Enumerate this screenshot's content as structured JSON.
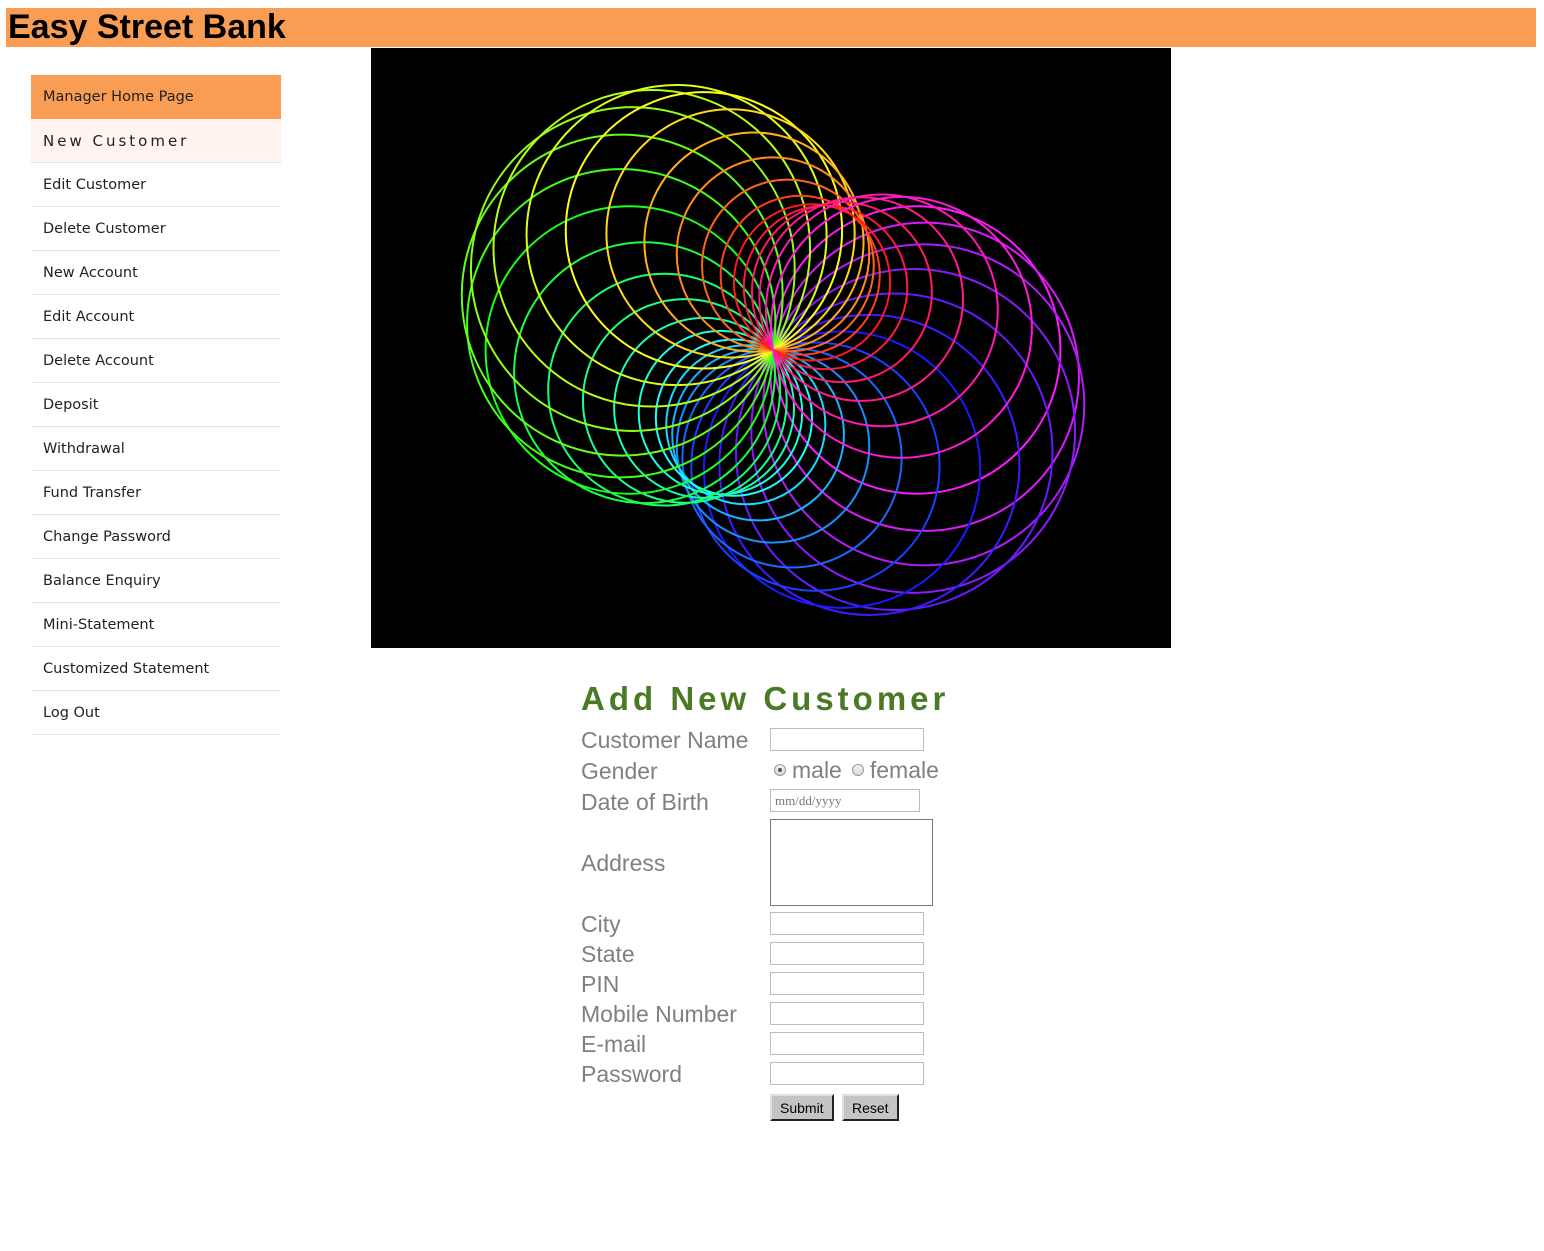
{
  "header": {
    "title": "Easy Street Bank"
  },
  "sidebar": {
    "items": [
      {
        "label": "Manager Home Page"
      },
      {
        "label": "New Customer"
      },
      {
        "label": "Edit Customer"
      },
      {
        "label": "Delete Customer"
      },
      {
        "label": "New Account"
      },
      {
        "label": "Edit Account"
      },
      {
        "label": "Delete Account"
      },
      {
        "label": "Deposit"
      },
      {
        "label": "Withdrawal"
      },
      {
        "label": "Fund Transfer"
      },
      {
        "label": "Change Password"
      },
      {
        "label": "Balance Enquiry"
      },
      {
        "label": "Mini-Statement"
      },
      {
        "label": "Customized Statement"
      },
      {
        "label": "Log Out"
      }
    ]
  },
  "form": {
    "title": "Add New Customer",
    "labels": {
      "customer_name": "Customer Name",
      "gender": "Gender",
      "dob": "Date of Birth",
      "address": "Address",
      "city": "City",
      "state": "State",
      "pin": "PIN",
      "mobile": "Mobile Number",
      "email": "E-mail",
      "password": "Password"
    },
    "gender_options": {
      "male": "male",
      "female": "female",
      "selected": "male"
    },
    "dob_placeholder": "mm/dd/yyyy",
    "submit_label": "Submit",
    "reset_label": "Reset"
  },
  "colors": {
    "header_bg": "#f89d53",
    "title_green": "#4a7a23",
    "label_gray": "#808080"
  },
  "icons": {
    "banner": "rainbow-spirograph-graphic"
  }
}
